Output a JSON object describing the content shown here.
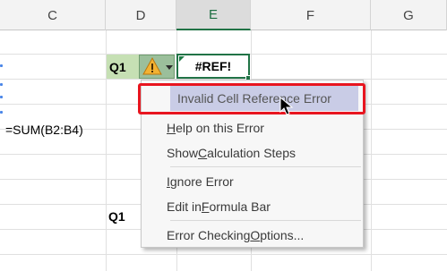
{
  "columns": [
    "C",
    "D",
    "E",
    "F",
    "G"
  ],
  "cells": {
    "d_row_label": "Q1",
    "e_error_value": "#REF!",
    "c_formula": "=SUM(B2:B4)",
    "d_lower_label": "Q1"
  },
  "error_button": {
    "icon": "warning-icon",
    "accent": "#9bbf9b"
  },
  "context_menu": {
    "items": [
      {
        "label": "Invalid Cell Reference Error",
        "highlighted": true
      },
      {
        "label_pre": "",
        "label_u": "H",
        "label_post": "elp on this Error"
      },
      {
        "label_pre": "Show ",
        "label_u": "C",
        "label_post": "alculation Steps"
      },
      {
        "label_pre": "",
        "label_u": "I",
        "label_post": "gnore Error"
      },
      {
        "label_pre": "Edit in ",
        "label_u": "F",
        "label_post": "ormula Bar"
      },
      {
        "label_pre": "Error Checking ",
        "label_u": "O",
        "label_post": "ptions..."
      }
    ]
  },
  "colors": {
    "header_accent": "#217346",
    "q1_fill": "#c6e0b4",
    "highlight_border": "#e8151f",
    "menu_highlight": "#c9cce6"
  }
}
